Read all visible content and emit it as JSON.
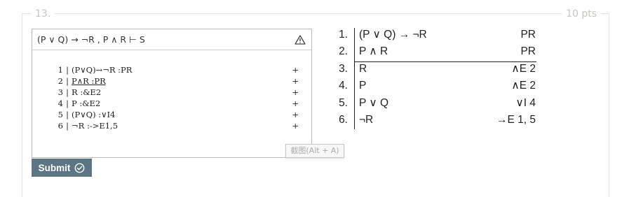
{
  "question": {
    "number": "13.",
    "points": "10 pts"
  },
  "editor": {
    "sequent": "(P ∨ Q) → ¬R , P ∧ R ⊢ S",
    "warning_icon": "warning-icon",
    "lines": [
      {
        "num": "1",
        "text": "(P∨Q)→¬R :PR",
        "mark": "+"
      },
      {
        "num": "2",
        "text": "P∧R :PR",
        "mark": "+"
      },
      {
        "num": "3",
        "text": "R :&E2",
        "mark": "+"
      },
      {
        "num": "4",
        "text": "P :&E2",
        "mark": "+"
      },
      {
        "num": "5",
        "text": "(P∨Q) :∨I4",
        "mark": "+"
      },
      {
        "num": "6",
        "text": "¬R :->E1,5",
        "mark": "+"
      }
    ]
  },
  "tooltip": {
    "text": "截图(Alt + A)"
  },
  "submit": {
    "label": "Submit",
    "icon": "check-circle-icon"
  },
  "proof": {
    "rows": [
      {
        "num": "1.",
        "formula": "(P ∨ Q) → ¬R",
        "just": "PR"
      },
      {
        "num": "2.",
        "formula": "P ∧ R",
        "just": "PR"
      },
      {
        "num": "3.",
        "formula": "R",
        "just": "∧E 2"
      },
      {
        "num": "4.",
        "formula": "P",
        "just": "∧E 2"
      },
      {
        "num": "5.",
        "formula": "P ∨ Q",
        "just": "∨I 4"
      },
      {
        "num": "6.",
        "formula": "¬R",
        "just": "→E 1, 5"
      }
    ]
  }
}
